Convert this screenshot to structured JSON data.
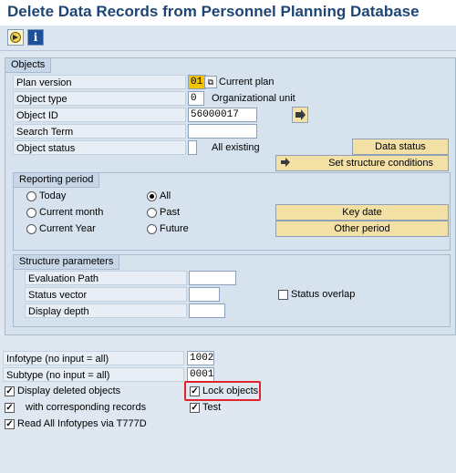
{
  "title": "Delete Data Records from Personnel Planning Database",
  "toolbar": {
    "execute_icon": "execute-icon",
    "info_icon": "information-icon",
    "info_glyph": "i"
  },
  "objects": {
    "group_title": "Objects",
    "plan_version": {
      "label": "Plan version",
      "value": "01",
      "description": "Current plan"
    },
    "object_type": {
      "label": "Object type",
      "value": "0",
      "description": "Organizational unit"
    },
    "object_id": {
      "label": "Object ID",
      "value": "56000017"
    },
    "search_term": {
      "label": "Search Term",
      "value": ""
    },
    "object_status": {
      "label": "Object status",
      "value": "",
      "description": "All existing"
    },
    "data_status_button": "Data status",
    "structure_conditions_button": "Set structure conditions"
  },
  "reporting_period": {
    "group_title": "Reporting period",
    "options": [
      "Today",
      "Current month",
      "Current Year",
      "All",
      "Past",
      "Future"
    ],
    "selected": "All",
    "key_date_button": "Key date",
    "other_period_button": "Other period"
  },
  "structure_params": {
    "group_title": "Structure parameters",
    "evaluation_path": "Evaluation Path",
    "status_vector": "Status vector",
    "display_depth": "Display depth",
    "status_overlap": "Status overlap"
  },
  "selection": {
    "infotype_label": "Infotype (no input = all)",
    "infotype_value": "1002",
    "subtype_label": "Subtype (no input = all)",
    "subtype_value": "0001",
    "display_deleted": "Display deleted objects",
    "with_corresponding": "with corresponding records",
    "read_all_infotypes": "Read All Infotypes via T777D",
    "lock_objects": "Lock objects",
    "test": "Test"
  },
  "colors": {
    "title": "#1e4675",
    "button": "#f2e0a4",
    "highlight": "#e0242b"
  }
}
